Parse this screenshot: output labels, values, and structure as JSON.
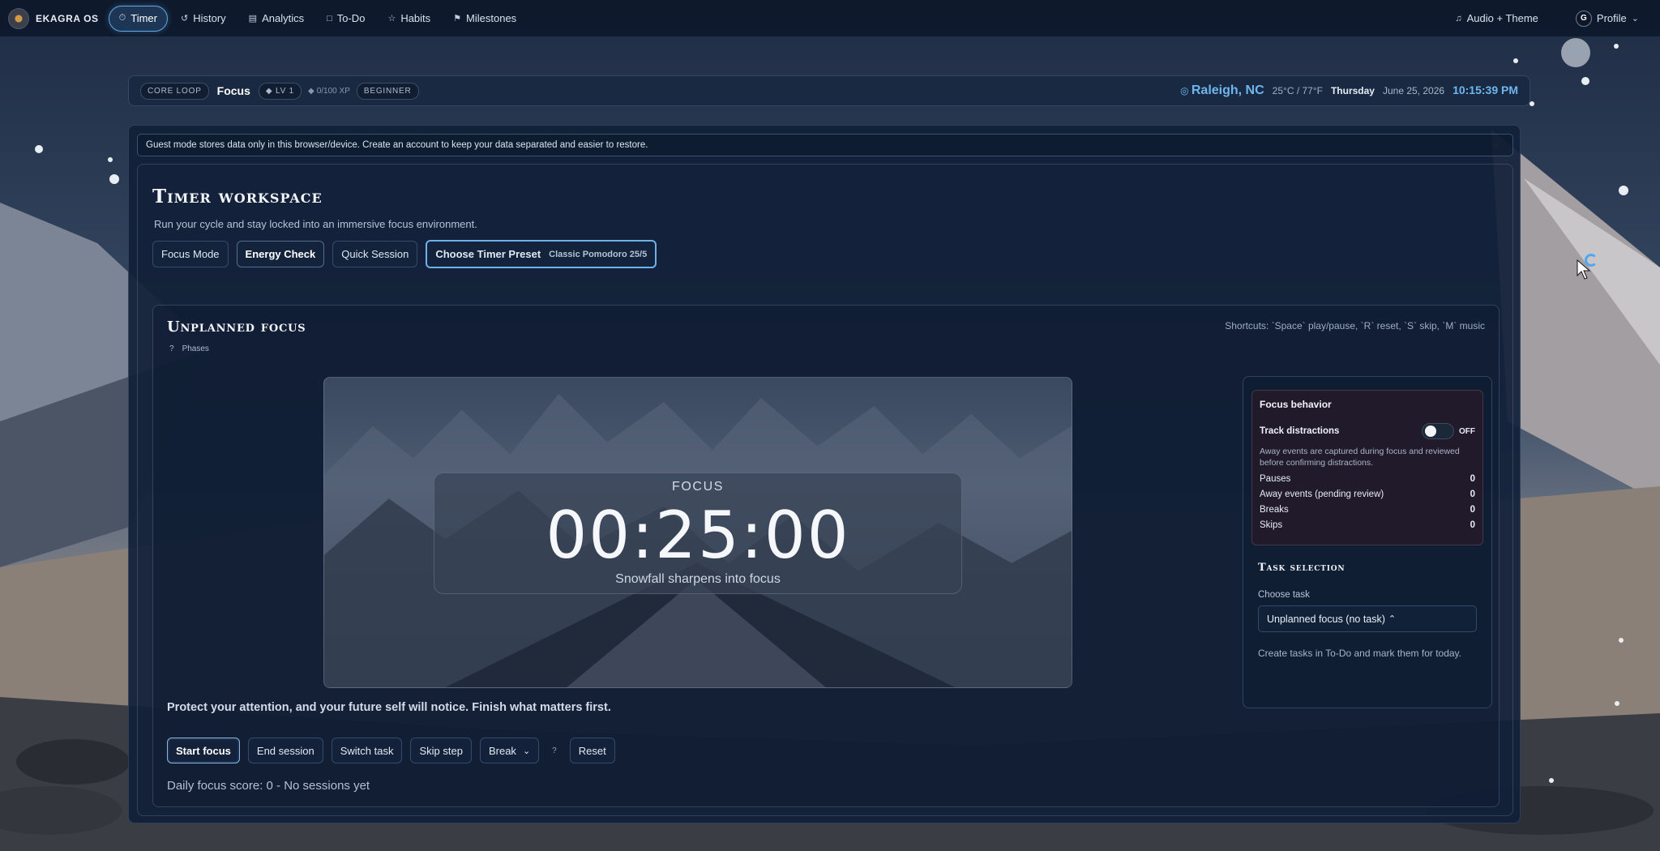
{
  "nav": {
    "brand": "EKAGRA OS",
    "items": [
      {
        "label": "Timer",
        "icon": "timer-icon",
        "active": true
      },
      {
        "label": "History",
        "icon": "history-icon"
      },
      {
        "label": "Analytics",
        "icon": "analytics-icon"
      },
      {
        "label": "To-Do",
        "icon": "todo-icon"
      },
      {
        "label": "Habits",
        "icon": "habits-icon"
      },
      {
        "label": "Milestones",
        "icon": "milestones-icon"
      }
    ],
    "audio_theme": "Audio + Theme",
    "profile_initial": "G",
    "profile_label": "Profile"
  },
  "status": {
    "core_loop": "CORE LOOP",
    "mode": "Focus",
    "level": "LV 1",
    "xp": "0/100 XP",
    "rank": "BEGINNER",
    "city": "Raleigh, NC",
    "temp": "25°C / 77°F",
    "day": "Thursday",
    "date": "June 25, 2026",
    "time": "10:15:39 PM"
  },
  "guest_notice": "Guest mode stores data only in this browser/device. Create an account to keep your data separated and easier to restore.",
  "workspace": {
    "title": "Timer workspace",
    "subtitle": "Run your cycle and stay locked into an immersive focus environment.",
    "tabs": {
      "focus_mode": "Focus Mode",
      "energy_check": "Energy Check",
      "quick_session": "Quick Session",
      "preset_label": "Choose Timer Preset",
      "preset_value": "Classic Pomodoro 25/5"
    }
  },
  "focus": {
    "title": "Unplanned focus",
    "phases_q": "?",
    "phases_label": "Phases",
    "shortcuts": "Shortcuts: `Space` play/pause, `R` reset, `S` skip, `M` music",
    "phase": "FOCUS",
    "time": "00:25:00",
    "tagline": "Snowfall sharpens into focus",
    "quote": "Protect your attention, and your future self will notice. Finish what matters first.",
    "actions": {
      "start": "Start focus",
      "end": "End session",
      "switch": "Switch task",
      "skip": "Skip step",
      "break": "Break",
      "help": "?",
      "reset": "Reset"
    },
    "score": "Daily focus score: 0 - No sessions yet"
  },
  "side": {
    "behavior_title": "Focus behavior",
    "track_label": "Track distractions",
    "toggle_state": "OFF",
    "note": "Away events are captured during focus and reviewed before confirming distractions.",
    "stats": [
      {
        "label": "Pauses",
        "value": "0"
      },
      {
        "label": "Away events (pending review)",
        "value": "0"
      },
      {
        "label": "Breaks",
        "value": "0"
      },
      {
        "label": "Skips",
        "value": "0"
      }
    ],
    "task_title": "Task selection",
    "choose_label": "Choose task",
    "task_value": "Unplanned focus (no task)",
    "create_note": "Create tasks in To-Do and mark them for today."
  },
  "colors": {
    "accent": "#5fa9e6",
    "city": "#6fb6ef",
    "panel": "#112038"
  }
}
